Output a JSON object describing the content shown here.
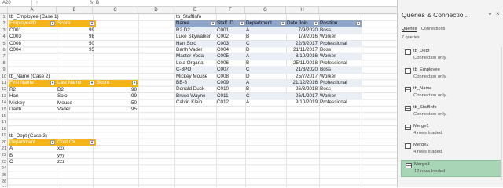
{
  "formula_bar": {
    "name_box": "A20",
    "fx": "fx",
    "value": "B"
  },
  "columns": [
    "A",
    "B",
    "C",
    "D",
    "E",
    "F",
    "G",
    "H"
  ],
  "rows": [
    "1",
    "2",
    "3",
    "4",
    "5",
    "6",
    "7",
    "8",
    "9",
    "10",
    "11",
    "12",
    "13",
    "14",
    "15",
    "16",
    "17",
    "18",
    "19",
    "20",
    "21",
    "22",
    "23",
    "24",
    "25",
    "26",
    "27"
  ],
  "employee_table": {
    "title": "tb_Employee (Case 1)",
    "headers": [
      "EmployeeID",
      "Score"
    ],
    "rows": [
      [
        "C001",
        "99"
      ],
      [
        "C003",
        "98"
      ],
      [
        "C008",
        "50"
      ],
      [
        "C004",
        "95"
      ]
    ]
  },
  "name_table": {
    "title": "tb_Name (Case 2)",
    "headers": [
      "First Name",
      "Last Name",
      "Score"
    ],
    "rows": [
      [
        "R2",
        "D2",
        "98"
      ],
      [
        "Han",
        "Solo",
        "99"
      ],
      [
        "Mickey",
        "Mouse",
        "50"
      ],
      [
        "Darth",
        "Vader",
        "95"
      ]
    ]
  },
  "dept_table": {
    "title": "tb_Dept (Case 3)",
    "headers": [
      "Department",
      "Cost Ctr"
    ],
    "rows": [
      [
        "A",
        "xxx"
      ],
      [
        "B",
        "yyy"
      ],
      [
        "C",
        "zzz"
      ]
    ]
  },
  "staff_table": {
    "title": "tb_StaffInfo",
    "headers": [
      "Name",
      "Staff ID",
      "Department",
      "Date Join",
      "Position"
    ],
    "rows": [
      [
        "R2 D2",
        "C001",
        "A",
        "7/9/2020",
        "Boss"
      ],
      [
        "Luke Skywalker",
        "C002",
        "B",
        "1/9/2016",
        "Worker"
      ],
      [
        "Han Solo",
        "C003",
        "C",
        "22/8/2017",
        "Professional"
      ],
      [
        "Darth Vader",
        "C004",
        "D",
        "21/11/2017",
        "Boss"
      ],
      [
        "Master Yoda",
        "C005",
        "A",
        "8/10/2016",
        "Worker"
      ],
      [
        "Leia Organa",
        "C006",
        "B",
        "25/11/2018",
        "Professional"
      ],
      [
        "C-3PO",
        "C007",
        "C",
        "21/8/2020",
        "Boss"
      ],
      [
        "Mickey Mouse",
        "C008",
        "D",
        "25/7/2017",
        "Worker"
      ],
      [
        "BB-8",
        "C009",
        "A",
        "21/12/2016",
        "Professional"
      ],
      [
        "Donald Duck",
        "C010",
        "B",
        "26/3/2018",
        "Boss"
      ],
      [
        "Bruce Wayne",
        "C011",
        "C",
        "26/1/2017",
        "Worker"
      ],
      [
        "Calvin Klein",
        "C012",
        "A",
        "9/10/2019",
        "Professional"
      ]
    ]
  },
  "queries_pane": {
    "title": "Queries & Connectio...",
    "tabs": [
      "Queries",
      "Connections"
    ],
    "count": "7 queries",
    "items": [
      {
        "name": "tb_Dept",
        "status": "Connection only."
      },
      {
        "name": "tb_Employee",
        "status": "Connection only."
      },
      {
        "name": "tb_Name",
        "status": "Connection only."
      },
      {
        "name": "tb_StaffInfo",
        "status": "Connection only."
      },
      {
        "name": "Merge1",
        "status": "4 rows loaded."
      },
      {
        "name": "Merge2",
        "status": "4 rows loaded."
      },
      {
        "name": "Merge3",
        "status": "12 rows loaded."
      }
    ],
    "accent": "#a8d5b6"
  }
}
